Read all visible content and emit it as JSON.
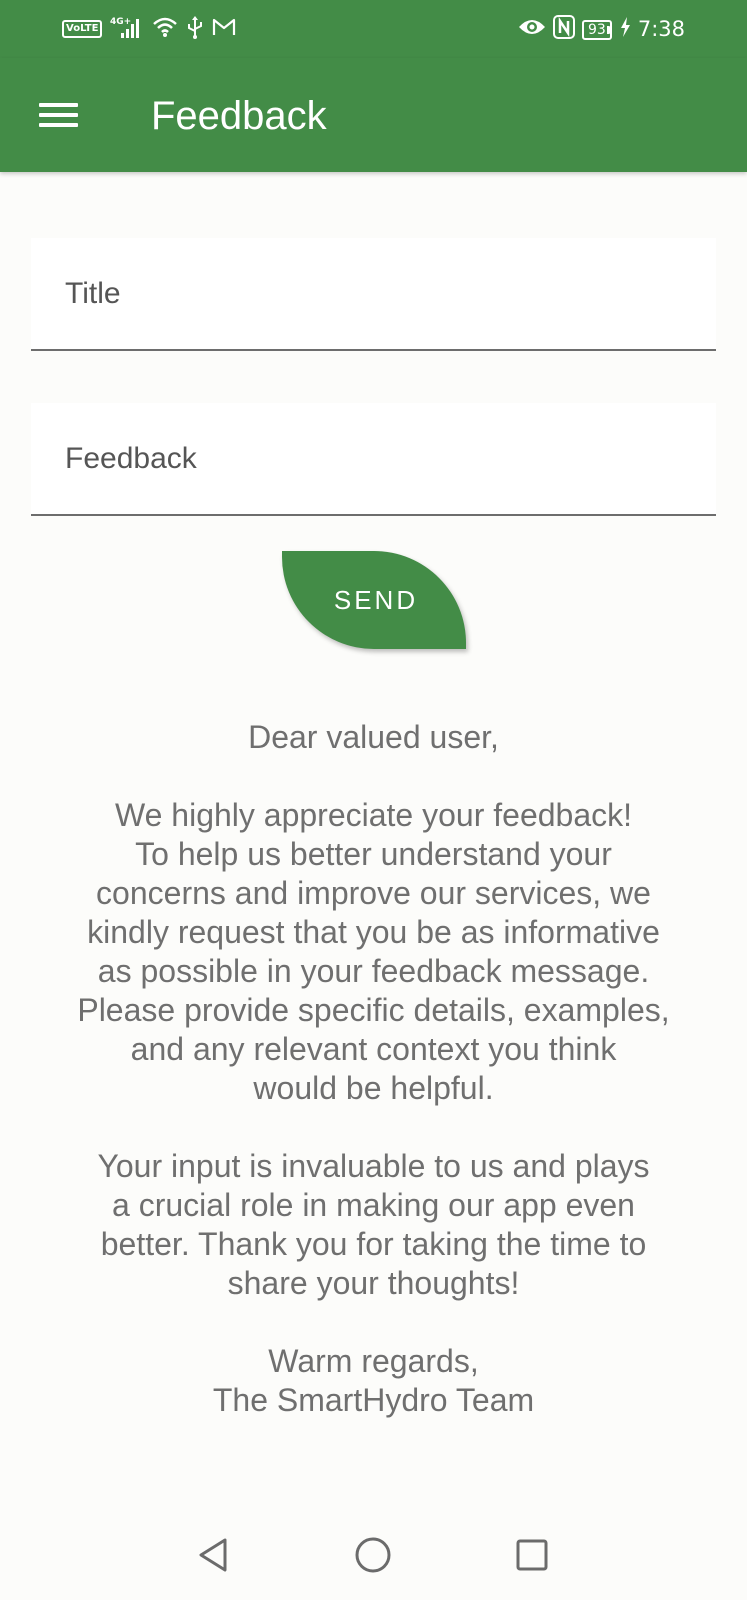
{
  "status_bar": {
    "volte": "VoLTE",
    "network": "4G+",
    "battery": "93",
    "time": "7:38",
    "icons": [
      "signal-icon",
      "wifi-icon",
      "usb-icon",
      "gmail-icon",
      "eye-icon",
      "nfc-icon",
      "battery-icon",
      "charging-icon"
    ]
  },
  "app_bar": {
    "title": "Feedback",
    "menu_icon": "hamburger-menu-icon"
  },
  "form": {
    "title_placeholder": "Title",
    "title_value": "",
    "feedback_placeholder": "Feedback",
    "feedback_value": "",
    "send_label": "SEND"
  },
  "message": {
    "greeting": "Dear valued user,",
    "paragraph1_lines": [
      "We highly appreciate your feedback!",
      "To help us better understand your",
      "concerns and improve our services, we",
      "kindly request that you be as informative",
      "as possible in your feedback message.",
      "Please provide specific details, examples,",
      "and any relevant context you think",
      "would be helpful."
    ],
    "paragraph2_lines": [
      "Your input is invaluable to us and plays",
      "a crucial role in making our app even",
      "better. Thank you for taking the time to",
      "share your thoughts!"
    ],
    "closing": "Warm regards,",
    "signature": "The SmartHydro Team"
  },
  "colors": {
    "primary": "#438c47",
    "background": "#fcfcfa",
    "text_secondary": "#6f6f6f"
  }
}
